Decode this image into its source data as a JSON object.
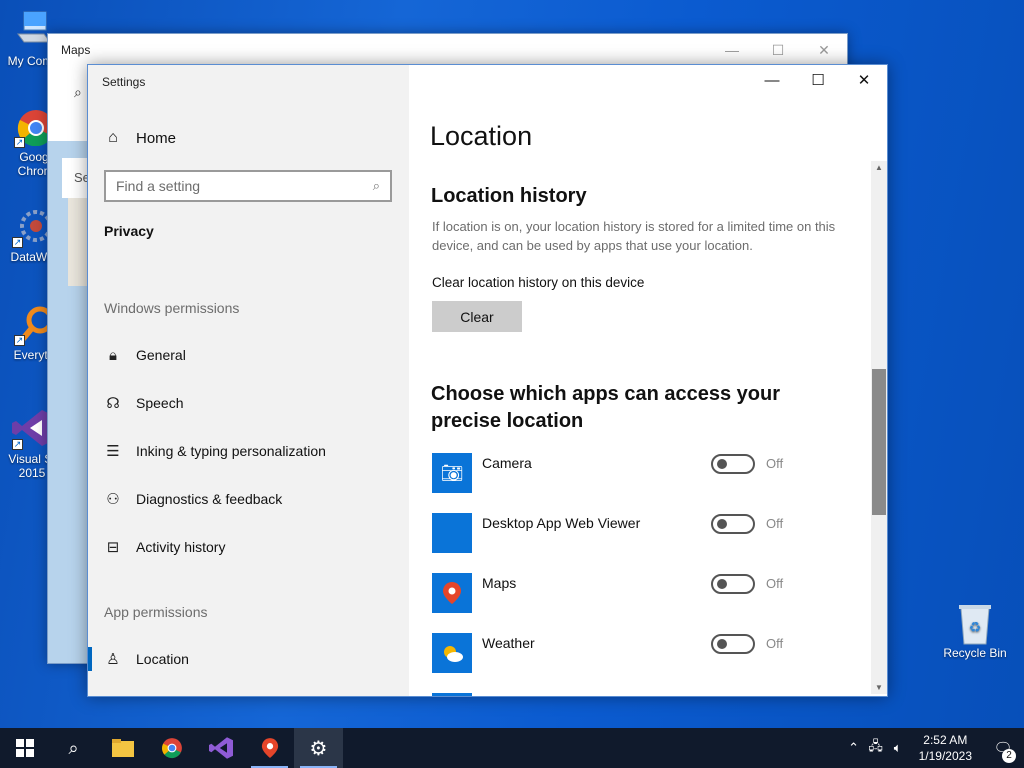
{
  "desktop": {
    "icons": [
      {
        "label": "My Com",
        "icon": "computer-icon"
      },
      {
        "label": "Goog",
        "label2": "Chron",
        "icon": "chrome-icon"
      },
      {
        "label": "DataWa",
        "icon": "datawarrior-icon"
      },
      {
        "label": "Everyth",
        "icon": "everything-search-icon"
      },
      {
        "label": "Visual St",
        "label2": "2015",
        "icon": "visual-studio-icon"
      },
      {
        "label": "Recycle Bin",
        "icon": "recycle-bin-icon"
      }
    ]
  },
  "maps_window": {
    "title": "Maps",
    "search_placeholder": "Se"
  },
  "settings": {
    "window_title": "Settings",
    "home_label": "Home",
    "search_placeholder": "Find a setting",
    "category": "Privacy",
    "windows_permissions_label": "Windows permissions",
    "windows_permissions": [
      {
        "label": "General",
        "icon": "lock-icon"
      },
      {
        "label": "Speech",
        "icon": "speech-icon"
      },
      {
        "label": "Inking & typing personalization",
        "icon": "clipboard-icon"
      },
      {
        "label": "Diagnostics & feedback",
        "icon": "feedback-icon"
      },
      {
        "label": "Activity history",
        "icon": "timeline-icon"
      }
    ],
    "app_permissions_label": "App permissions",
    "app_permissions": [
      {
        "label": "Location",
        "icon": "location-icon",
        "active": true
      }
    ],
    "content": {
      "page_title": "Location",
      "history_heading": "Location history",
      "history_description": "If location is on, your location history is stored for a limited time on this device, and can be used by apps that use your location.",
      "clear_label": "Clear location history on this device",
      "clear_button": "Clear",
      "apps_heading": "Choose which apps can access your precise location",
      "apps": [
        {
          "name": "Camera",
          "icon": "camera-icon",
          "state": "Off"
        },
        {
          "name": "Desktop App Web Viewer",
          "icon": "blank-app-icon",
          "state": "Off"
        },
        {
          "name": "Maps",
          "icon": "maps-icon",
          "state": "Off"
        },
        {
          "name": "Weather",
          "icon": "weather-icon",
          "state": "Off"
        }
      ]
    }
  },
  "taskbar": {
    "time": "2:52 AM",
    "date": "1/19/2023",
    "notification_count": "2"
  }
}
